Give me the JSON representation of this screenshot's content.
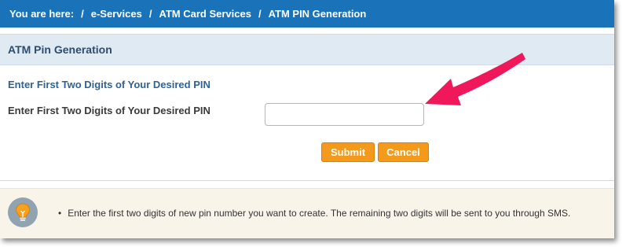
{
  "breadcrumb": {
    "prefix": "You are here:",
    "separator": "/",
    "items": [
      "e-Services",
      "ATM Card Services",
      "ATM PIN Generation"
    ]
  },
  "panel": {
    "title": "ATM Pin Generation",
    "subheading": "Enter First Two Digits of Your Desired PIN",
    "field_label": "Enter First Two Digits of Your Desired PIN",
    "pin_value": "",
    "pin_placeholder": ""
  },
  "buttons": {
    "submit": "Submit",
    "cancel": "Cancel"
  },
  "info": {
    "icon": "lightbulb-icon",
    "bullet": "•",
    "text": "Enter the first two digits of new pin number you want to create. The remaining two digits will be sent to you through SMS."
  },
  "colors": {
    "breadcrumb_bg": "#1a73b8",
    "panel_header_bg": "#dfeaf3",
    "button_bg": "#f39a1c",
    "info_bg": "#f9f4ea",
    "annotation_arrow": "#f0185a"
  }
}
